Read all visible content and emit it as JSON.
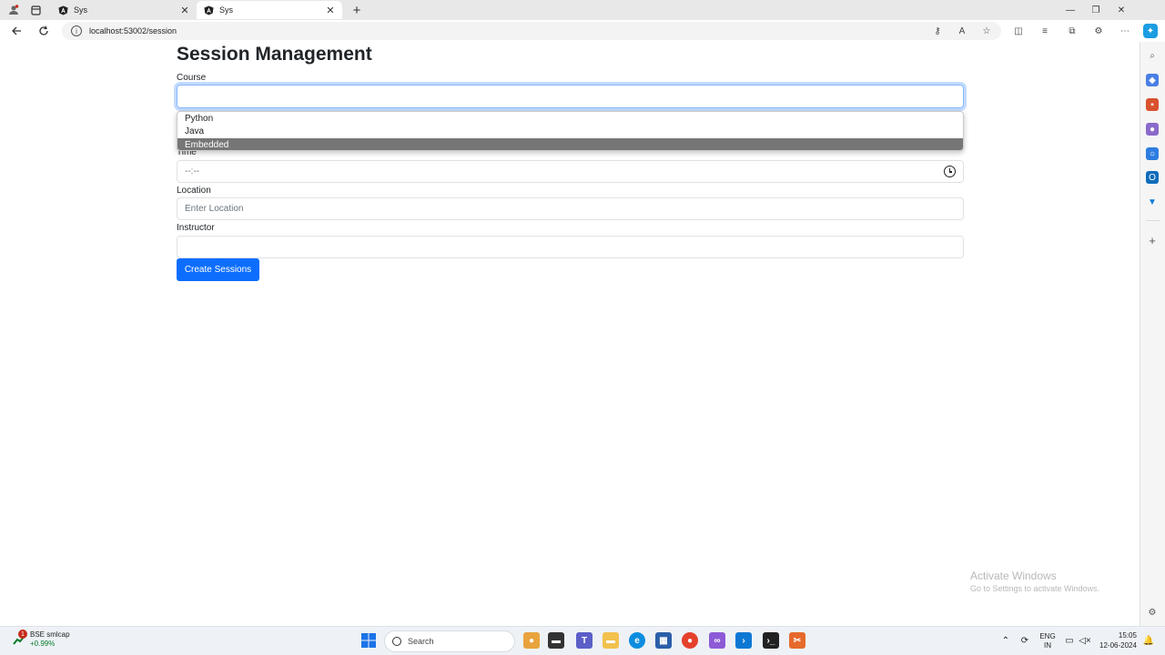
{
  "browser": {
    "tabs": [
      {
        "title": "Sys",
        "active": false
      },
      {
        "title": "Sys",
        "active": true
      }
    ],
    "url": "localhost:53002/session"
  },
  "page": {
    "title": "Session Management",
    "course": {
      "label": "Course",
      "value": "",
      "options": [
        "Python",
        "Java",
        "Embedded"
      ],
      "highlighted": "Embedded"
    },
    "time": {
      "label": "Time",
      "value": "--:--"
    },
    "location": {
      "label": "Location",
      "placeholder": "Enter Location"
    },
    "instructor": {
      "label": "Instructor",
      "value": ""
    },
    "submit_label": "Create Sessions"
  },
  "watermark": {
    "line1": "Activate Windows",
    "line2": "Go to Settings to activate Windows."
  },
  "taskbar": {
    "stock": {
      "name": "BSE smlcap",
      "change": "+0.99%",
      "badge": "1"
    },
    "search_placeholder": "Search",
    "language": {
      "top": "ENG",
      "bottom": "IN"
    },
    "time": "15:05",
    "date": "12-06-2024"
  },
  "colors": {
    "primary": "#0d6efd",
    "dropdown_highlight": "#767676",
    "focus_border": "#86b7fe"
  }
}
